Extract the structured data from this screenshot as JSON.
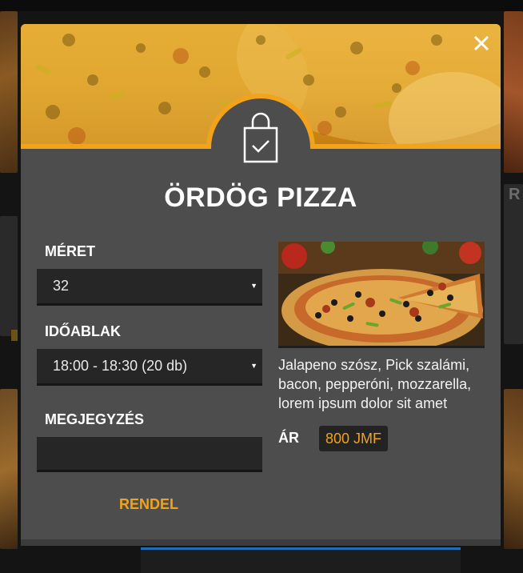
{
  "background": {
    "partial_letter": "R"
  },
  "modal": {
    "title": "ÖRDÖG PIZZA",
    "close_icon": "close-icon",
    "badge_icon": "shopping-bag-check-icon",
    "accent_color": "#f2a31c",
    "size": {
      "label": "MÉRET",
      "selected": "32"
    },
    "timeslot": {
      "label": "IDŐABLAK",
      "selected": "18:00 - 18:30 (20 db)"
    },
    "note": {
      "label": "MEGJEGYZÉS",
      "value": ""
    },
    "order_button_label": "RENDEL",
    "description": "Jalapeno szósz, Pick szalámi, bacon, pepperóni, mozzarella, lorem ipsum dolor sit amet",
    "price": {
      "label": "ÁR",
      "value": "800 JMF"
    }
  }
}
